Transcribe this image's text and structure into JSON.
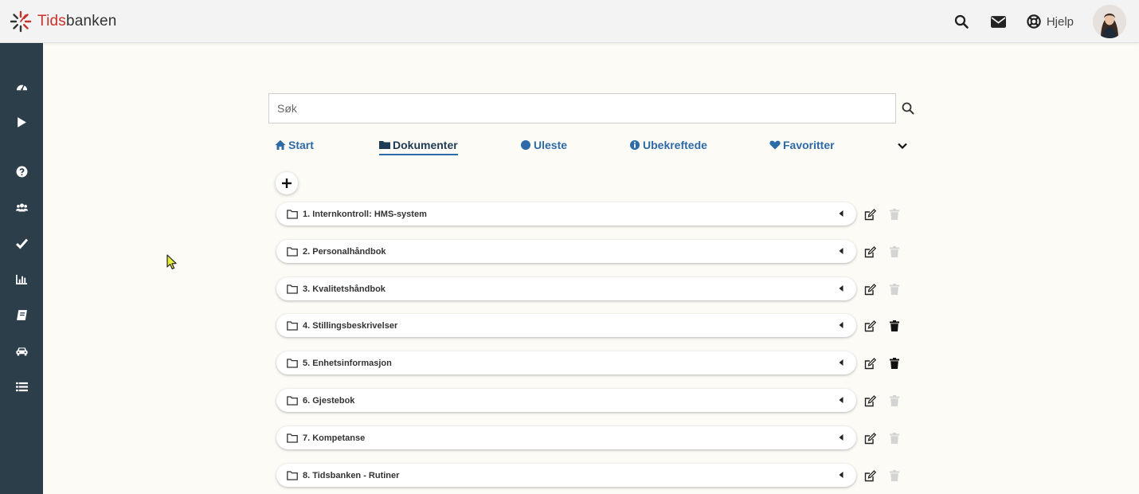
{
  "app": {
    "brand_part1": "Tids",
    "brand_part2": "banken",
    "brand_color": "#c8322b",
    "sidebar_color": "#2c3e4a",
    "link_color": "#2c6aa8"
  },
  "header": {
    "icons": [
      "search-icon",
      "envelope-icon",
      "lifebuoy-icon"
    ],
    "help_label": "Hjelp"
  },
  "sidebar": {
    "items": [
      {
        "icon": "dashboard-icon"
      },
      {
        "icon": "play-icon"
      },
      {
        "icon": "question-icon"
      },
      {
        "icon": "users-icon"
      },
      {
        "icon": "check-icon"
      },
      {
        "icon": "bar-chart-icon"
      },
      {
        "icon": "book-icon"
      },
      {
        "icon": "car-icon"
      },
      {
        "icon": "list-icon"
      }
    ]
  },
  "search": {
    "placeholder": "Søk",
    "value": ""
  },
  "tabs": [
    {
      "label": "Start",
      "icon": "home-icon",
      "active": false
    },
    {
      "label": "Dokumenter",
      "icon": "folder-icon",
      "active": true
    },
    {
      "label": "Uleste",
      "icon": "circle-icon",
      "active": false
    },
    {
      "label": "Ubekreftede",
      "icon": "info-circle-icon",
      "active": false
    },
    {
      "label": "Favoritter",
      "icon": "heart-icon",
      "active": false
    }
  ],
  "folders": [
    {
      "label": "1. Internkontroll: HMS-system",
      "delete_enabled": false
    },
    {
      "label": "2. Personalhåndbok",
      "delete_enabled": false
    },
    {
      "label": "3. Kvalitetshåndbok",
      "delete_enabled": false
    },
    {
      "label": "4. Stillingsbeskrivelser",
      "delete_enabled": true
    },
    {
      "label": "5. Enhetsinformasjon",
      "delete_enabled": true
    },
    {
      "label": "6. Gjestebok",
      "delete_enabled": false
    },
    {
      "label": "7. Kompetanse",
      "delete_enabled": false
    },
    {
      "label": "8. Tidsbanken - Rutiner",
      "delete_enabled": false
    }
  ]
}
